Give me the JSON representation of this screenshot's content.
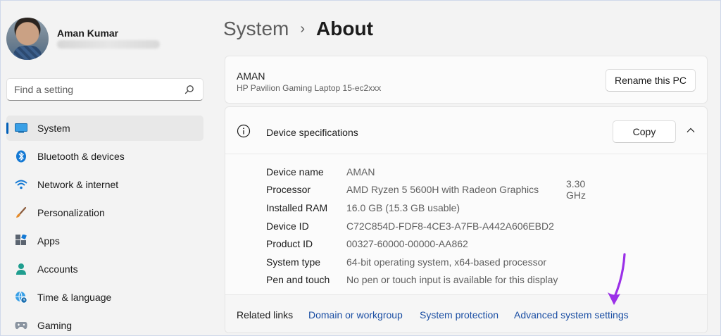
{
  "user": {
    "name": "Aman Kumar"
  },
  "search": {
    "placeholder": "Find a setting"
  },
  "sidebar": {
    "items": [
      {
        "label": "System",
        "icon": "system-icon",
        "active": true
      },
      {
        "label": "Bluetooth & devices",
        "icon": "bluetooth-icon"
      },
      {
        "label": "Network & internet",
        "icon": "wifi-icon"
      },
      {
        "label": "Personalization",
        "icon": "brush-icon"
      },
      {
        "label": "Apps",
        "icon": "apps-icon"
      },
      {
        "label": "Accounts",
        "icon": "accounts-icon"
      },
      {
        "label": "Time & language",
        "icon": "globe-clock-icon"
      },
      {
        "label": "Gaming",
        "icon": "gamepad-icon"
      }
    ]
  },
  "breadcrumb": {
    "parent": "System",
    "separator": "›",
    "current": "About"
  },
  "pc": {
    "name": "AMAN",
    "model": "HP Pavilion Gaming Laptop 15-ec2xxx",
    "rename_label": "Rename this PC"
  },
  "specs": {
    "title": "Device specifications",
    "copy_label": "Copy",
    "rows": [
      {
        "label": "Device name",
        "value": "AMAN"
      },
      {
        "label": "Processor",
        "value": "AMD Ryzen 5 5600H with Radeon Graphics",
        "extra": "3.30 GHz"
      },
      {
        "label": "Installed RAM",
        "value": "16.0 GB (15.3 GB usable)"
      },
      {
        "label": "Device ID",
        "value": "C72C854D-FDF8-4CE3-A7FB-A442A606EBD2"
      },
      {
        "label": "Product ID",
        "value": "00327-60000-00000-AA862"
      },
      {
        "label": "System type",
        "value": "64-bit operating system, x64-based processor"
      },
      {
        "label": "Pen and touch",
        "value": "No pen or touch input is available for this display"
      }
    ]
  },
  "related": {
    "label": "Related links",
    "links": [
      "Domain or workgroup",
      "System protection",
      "Advanced system settings"
    ]
  },
  "colors": {
    "accent": "#005fb8",
    "link": "#1a4ea3",
    "annotation_arrow": "#9b30e8"
  }
}
